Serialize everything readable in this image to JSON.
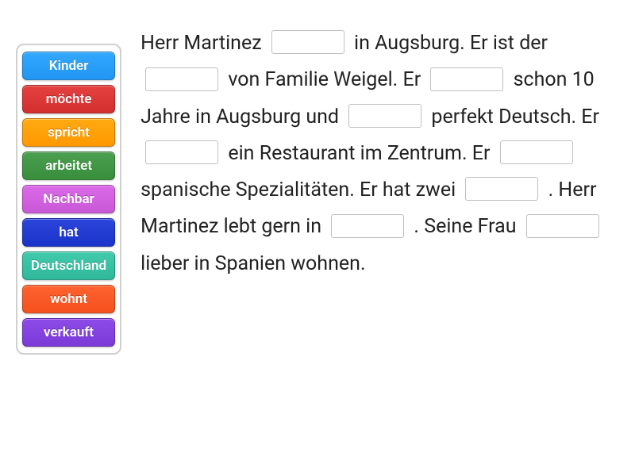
{
  "word_bank": [
    {
      "label": "Kinder",
      "color": "#2196f3"
    },
    {
      "label": "möchte",
      "color": "#d32f2f"
    },
    {
      "label": "spricht",
      "color": "#ff9800"
    },
    {
      "label": "arbeitet",
      "color": "#388e3c"
    },
    {
      "label": "Nachbar",
      "color": "#c858d6"
    },
    {
      "label": "hat",
      "color": "#1a33c9"
    },
    {
      "label": "Deutschland",
      "color": "#2fb89a"
    },
    {
      "label": "wohnt",
      "color": "#f4511e"
    },
    {
      "label": "verkauft",
      "color": "#7b39d6"
    }
  ],
  "text_tokens": [
    "Herr",
    "Martinez",
    "__BLANK__",
    "in",
    "Augsburg.",
    "Er",
    "ist",
    "der",
    "__BLANK__",
    "von",
    "Familie",
    "Weigel.",
    "Er",
    "__BLANK__",
    "schon",
    "10",
    "Jahre",
    "in",
    "Augsburg",
    "und",
    "__BLANK__",
    "perfekt",
    "Deutsch.",
    "Er",
    "__BLANK__",
    "ein",
    "Restaurant",
    "im",
    "Zentrum.",
    "Er",
    "__BLANK__",
    "spanische",
    "Spezialitäten.",
    "Er",
    "hat",
    "zwei",
    "__BLANK__",
    ".",
    "Herr",
    "Martinez",
    "lebt",
    "gern",
    "in",
    "__BLANK__",
    ".",
    "Seine",
    "Frau",
    "__BLANK__",
    "lieber",
    "in",
    "Spanien",
    "wohnen."
  ]
}
